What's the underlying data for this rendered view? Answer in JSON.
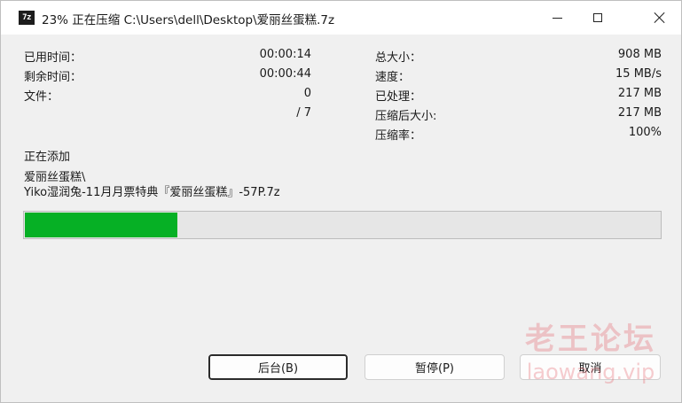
{
  "window": {
    "title": "23% 正在压缩 C:\\Users\\dell\\Desktop\\爱丽丝蛋糕.7z",
    "icon_text": "7z",
    "icon": "7zip-icon"
  },
  "stats_left": [
    {
      "label": "已用时间：",
      "value": "00:00:14"
    },
    {
      "label": "剩余时间：",
      "value": "00:00:44"
    },
    {
      "label": "文件：",
      "value": "0"
    },
    {
      "label": "",
      "value": "/ 7"
    }
  ],
  "stats_right": [
    {
      "label": "总大小：",
      "value": "908 MB"
    },
    {
      "label": "速度：",
      "value": "15 MB/s"
    },
    {
      "label": "已处理：",
      "value": "217 MB"
    },
    {
      "label": "压缩后大小:",
      "value": "217 MB"
    },
    {
      "label": "压缩率：",
      "value": "100%"
    }
  ],
  "status": {
    "heading": "正在添加",
    "folder": "爱丽丝蛋糕\\",
    "file": "Yiko湿润兔-11月月票特典『爱丽丝蛋糕』-57P.7z"
  },
  "progress": {
    "fraction": 0.24,
    "color": "#06b025"
  },
  "buttons": {
    "background": "后台(B)",
    "pause": "暂停(P)",
    "cancel": "取消"
  },
  "watermark": {
    "cn": "老王论坛",
    "en": "laowang.vip"
  }
}
